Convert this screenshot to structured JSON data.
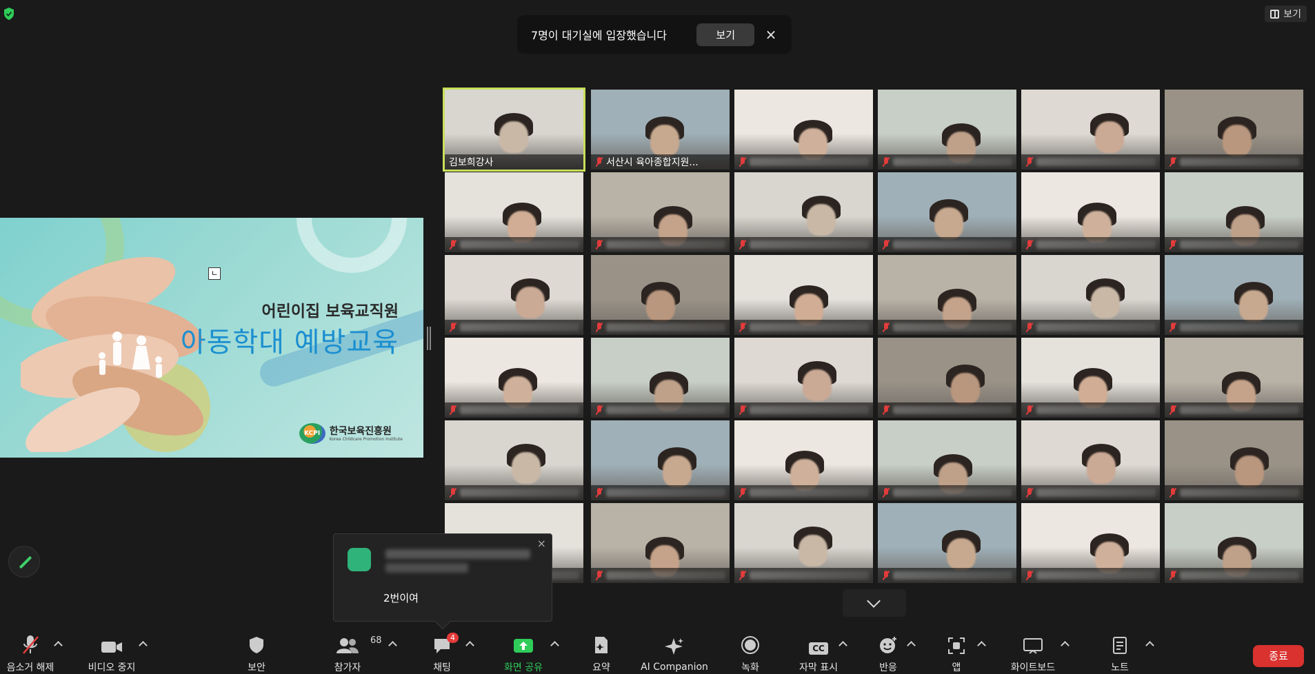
{
  "notification": {
    "text": "7명이 대기실에 입장했습니다",
    "view_label": "보기",
    "close_glyph": "×"
  },
  "view_button": {
    "label": "보기"
  },
  "shared_slide": {
    "subtitle": "어린이집 보육교직원",
    "title": "아동학대 예방교육",
    "cursor_glyph": "ㄴ",
    "logo_name": "한국보육진흥원",
    "logo_sub": "Korea Childcare Promotion Institute",
    "logo_mark": "KCPI"
  },
  "participants": [
    {
      "name": "김보희강사",
      "muted": false,
      "active": true
    },
    {
      "name": "서산시 육아종합지원...",
      "muted": true
    },
    {
      "name": "",
      "muted": true
    },
    {
      "name": "",
      "muted": true
    },
    {
      "name": "",
      "muted": true
    },
    {
      "name": "",
      "muted": true
    },
    {
      "name": "",
      "muted": true
    },
    {
      "name": "",
      "muted": true
    },
    {
      "name": "",
      "muted": true
    },
    {
      "name": "",
      "muted": true
    },
    {
      "name": "",
      "muted": true
    },
    {
      "name": "",
      "muted": true
    },
    {
      "name": "",
      "muted": true
    },
    {
      "name": "",
      "muted": true
    },
    {
      "name": "",
      "muted": true
    },
    {
      "name": "",
      "muted": true
    },
    {
      "name": "",
      "muted": true
    },
    {
      "name": "",
      "muted": true
    },
    {
      "name": "",
      "muted": true
    },
    {
      "name": "",
      "muted": true
    },
    {
      "name": "",
      "muted": true
    },
    {
      "name": "",
      "muted": true
    },
    {
      "name": "",
      "muted": true
    },
    {
      "name": "",
      "muted": true
    },
    {
      "name": "",
      "muted": true
    },
    {
      "name": "",
      "muted": true
    },
    {
      "name": "",
      "muted": true
    },
    {
      "name": "",
      "muted": true
    },
    {
      "name": "",
      "muted": true
    },
    {
      "name": "",
      "muted": true
    },
    {
      "name": "",
      "muted": true
    },
    {
      "name": "",
      "muted": true
    },
    {
      "name": "",
      "muted": true
    },
    {
      "name": "",
      "muted": true
    },
    {
      "name": "",
      "muted": true
    },
    {
      "name": "",
      "muted": true
    }
  ],
  "chat_popup": {
    "message": "2번이여",
    "close_glyph": "×"
  },
  "toolbar": {
    "audio": "음소거 해제",
    "video": "비디오 중지",
    "security": "보안",
    "participants": "참가자",
    "participants_count": "68",
    "chat": "채팅",
    "chat_badge": "4",
    "share": "화면 공유",
    "summary": "요약",
    "ai": "AI Companion",
    "record": "녹화",
    "captions": "자막 표시",
    "captions_icon": "CC",
    "reactions": "반응",
    "apps": "앱",
    "whiteboard": "화이트보드",
    "notes": "노트",
    "end": "종료"
  },
  "colors": {
    "accent_green": "#2fcc5a",
    "end_red": "#d9322f",
    "active_speaker": "#c8e05a",
    "muted_red": "#e23b3b"
  }
}
